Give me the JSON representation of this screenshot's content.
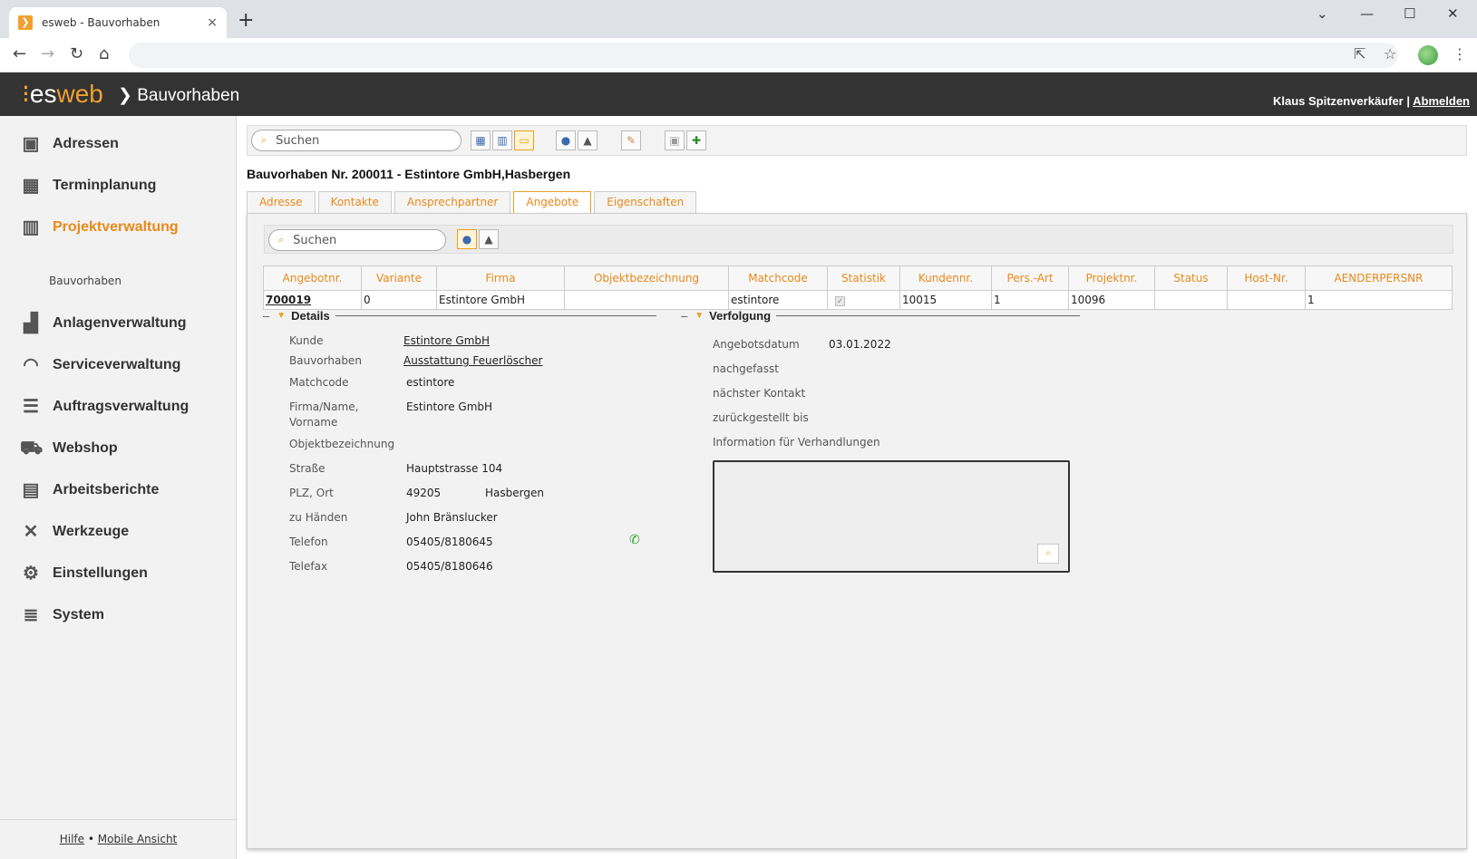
{
  "browser": {
    "tab_title": "esweb - Bauvorhaben",
    "tab_close": "×",
    "new_tab": "+"
  },
  "header": {
    "logo_es": "es",
    "logo_web": "web",
    "breadcrumb": "Bauvorhaben",
    "user": "Klaus Spitzenverkäufer",
    "separator": "|",
    "logout": "Abmelden"
  },
  "sidebar": {
    "items": [
      {
        "label": "Adressen",
        "icon": "address-book-icon"
      },
      {
        "label": "Terminplanung",
        "icon": "calendar-icon"
      },
      {
        "label": "Projektverwaltung",
        "icon": "project-icon"
      },
      {
        "label": "Anlagenverwaltung",
        "icon": "factory-icon"
      },
      {
        "label": "Serviceverwaltung",
        "icon": "headset-icon"
      },
      {
        "label": "Auftragsverwaltung",
        "icon": "list-icon"
      },
      {
        "label": "Webshop",
        "icon": "cart-icon"
      },
      {
        "label": "Arbeitsberichte",
        "icon": "clipboard-icon"
      },
      {
        "label": "Werkzeuge",
        "icon": "tools-icon"
      },
      {
        "label": "Einstellungen",
        "icon": "gear-icon"
      },
      {
        "label": "System",
        "icon": "database-icon"
      }
    ],
    "subitem": "Bauvorhaben",
    "footer_help": "Hilfe",
    "footer_dot": "•",
    "footer_mobile": "Mobile Ansicht"
  },
  "toolbar": {
    "search_placeholder": "Suchen"
  },
  "page_title": "Bauvorhaben Nr. 200011 - Estintore GmbH,Hasbergen",
  "tabs": [
    "Adresse",
    "Kontakte",
    "Ansprechpartner",
    "Angebote",
    "Eigenschaften"
  ],
  "subsearch_placeholder": "Suchen",
  "table": {
    "headers": [
      "Angebotnr.",
      "Variante",
      "Firma",
      "Objektbezeichnung",
      "Matchcode",
      "Statistik",
      "Kundennr.",
      "Pers.-Art",
      "Projektnr.",
      "Status",
      "Host-Nr.",
      "AENDERPERSNR"
    ],
    "row": [
      "700019",
      "0",
      "Estintore GmbH",
      "",
      "estintore",
      "",
      "10015",
      "1",
      "10096",
      "",
      "",
      "1"
    ]
  },
  "details": {
    "title": "Details",
    "toggle": "–",
    "kunde_label": "Kunde",
    "kunde": "Estintore GmbH",
    "bauvorhaben_label": "Bauvorhaben",
    "bauvorhaben": "Ausstattung Feuerlöscher",
    "matchcode_label": "Matchcode",
    "matchcode": "estintore",
    "firma_label1": "Firma/Name,",
    "firma_label2": "Vorname",
    "firma": "Estintore GmbH",
    "objekt_label": "Objektbezeichnung",
    "strasse_label": "Straße",
    "strasse": "Hauptstrasse 104",
    "plz_label": "PLZ, Ort",
    "plz": "49205",
    "ort": "Hasbergen",
    "zuhanden_label": "zu Händen",
    "zuhanden": "John Bränslucker",
    "telefon_label": "Telefon",
    "telefon": "05405/8180645",
    "telefax_label": "Telefax",
    "telefax": "05405/8180646"
  },
  "verfolgung": {
    "title": "Verfolgung",
    "toggle": "–",
    "angebotsdatum_label": "Angebotsdatum",
    "angebotsdatum": "03.01.2022",
    "nachgefasst_label": "nachgefasst",
    "naechster_label": "nächster Kontakt",
    "zurueck_label": "zurückgestellt bis",
    "info_label": "Information für Verhandlungen"
  }
}
